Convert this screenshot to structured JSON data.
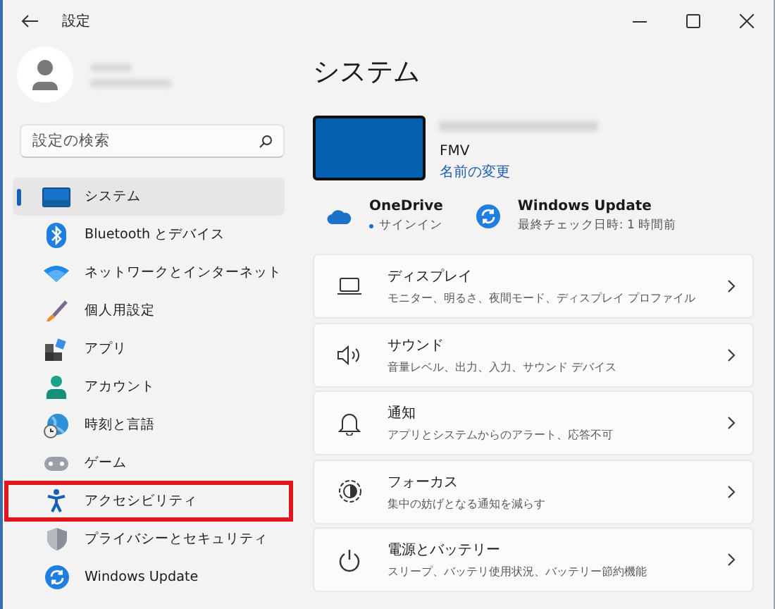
{
  "window": {
    "title": "設定"
  },
  "search": {
    "placeholder": "設定の検索"
  },
  "nav": [
    {
      "label": "システム",
      "selected": true,
      "highlighted": false
    },
    {
      "label": "Bluetooth とデバイス",
      "selected": false,
      "highlighted": false
    },
    {
      "label": "ネットワークとインターネット",
      "selected": false,
      "highlighted": false
    },
    {
      "label": "個人用設定",
      "selected": false,
      "highlighted": false
    },
    {
      "label": "アプリ",
      "selected": false,
      "highlighted": false
    },
    {
      "label": "アカウント",
      "selected": false,
      "highlighted": false
    },
    {
      "label": "時刻と言語",
      "selected": false,
      "highlighted": false
    },
    {
      "label": "ゲーム",
      "selected": false,
      "highlighted": false
    },
    {
      "label": "アクセシビリティ",
      "selected": false,
      "highlighted": true
    },
    {
      "label": "プライバシーとセキュリティ",
      "selected": false,
      "highlighted": false
    },
    {
      "label": "Windows Update",
      "selected": false,
      "highlighted": false
    }
  ],
  "page_title": "システム",
  "device": {
    "model": "FMV",
    "rename_link": "名前の変更"
  },
  "status": [
    {
      "title": "OneDrive",
      "detail": "サインイン"
    },
    {
      "title": "Windows Update",
      "detail": "最終チェック日時: 1 時間前"
    }
  ],
  "cards": [
    {
      "title": "ディスプレイ",
      "subtitle": "モニター、明るさ、夜間モード、ディスプレイ プロファイル"
    },
    {
      "title": "サウンド",
      "subtitle": "音量レベル、出力、入力、サウンド デバイス"
    },
    {
      "title": "通知",
      "subtitle": "アプリとシステムからのアラート、応答不可"
    },
    {
      "title": "フォーカス",
      "subtitle": "集中の妨げとなる通知を減らす"
    },
    {
      "title": "電源とバッテリー",
      "subtitle": "スリープ、バッテリ使用状況、バッテリー節約機能"
    }
  ]
}
